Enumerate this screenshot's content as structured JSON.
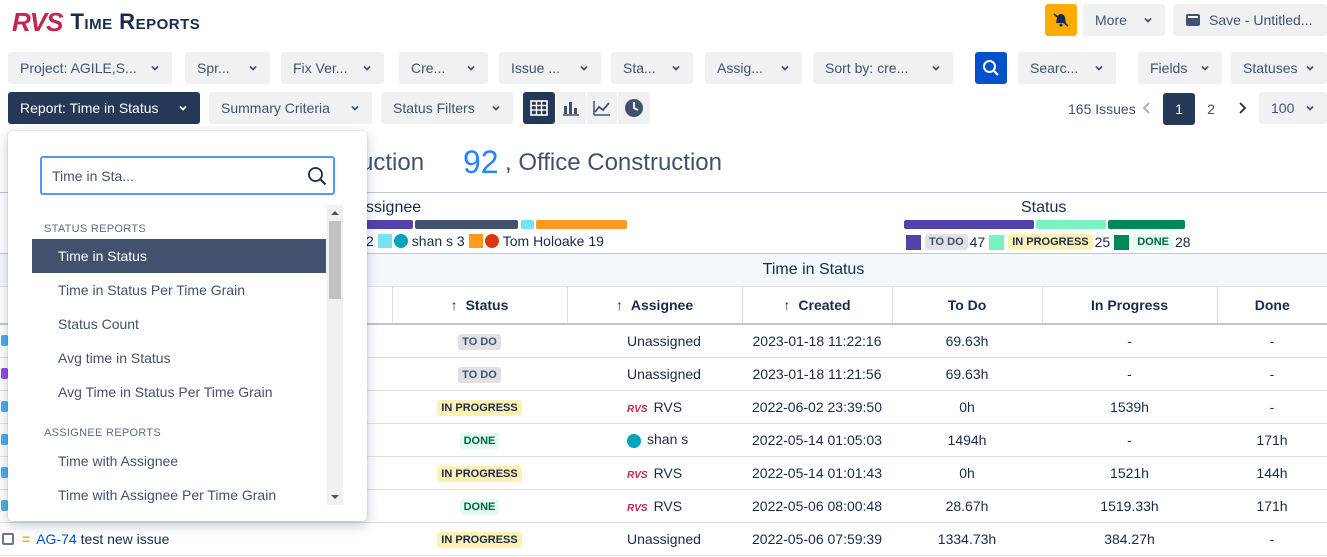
{
  "app": {
    "logo": "RVS",
    "title": "Time Reports"
  },
  "header": {
    "more_label": "More",
    "save_label": "Save - Untitled..."
  },
  "filters": [
    {
      "label": "Project: AGILE,S..."
    },
    {
      "label": "Spr..."
    },
    {
      "label": "Fix Ver..."
    },
    {
      "label": "Cre..."
    },
    {
      "label": "Issue ..."
    },
    {
      "label": "Sta..."
    },
    {
      "label": "Assig..."
    },
    {
      "label": "Sort by: cre..."
    }
  ],
  "search_filter": "Searc...",
  "fields_label": "Fields",
  "statuses_label": "Statuses",
  "report_button": "Report: Time in Status",
  "summary_criteria": "Summary Criteria",
  "status_filters": "Status Filters",
  "pagination": {
    "issues": "165 Issues",
    "pages": [
      "1",
      "2"
    ],
    "per_page": "100"
  },
  "project_titles": {
    "partial": "uction",
    "count": "92",
    "name": ", Office Construction"
  },
  "summary": {
    "assignee_label": "ssignee",
    "assignee_legend": [
      {
        "text": "2"
      },
      {
        "text": "shan s 3"
      },
      {
        "text": "Tom Holoake 19"
      }
    ],
    "status_label": "Status",
    "status_legend": [
      {
        "badge": "TO DO",
        "count": "47"
      },
      {
        "badge": "IN PROGRESS",
        "count": "25"
      },
      {
        "badge": "DONE",
        "count": "28"
      }
    ]
  },
  "table": {
    "group_header": "Time in Status",
    "columns": [
      "Status",
      "Assignee",
      "Created",
      "To Do",
      "In Progress",
      "Done"
    ],
    "sort_arrows": [
      "↑",
      "↑",
      "↑"
    ],
    "rows": [
      {
        "status": "TO DO",
        "assignee": "Unassigned",
        "created": "2023-01-18 11:22:16",
        "todo": "69.63h",
        "inprog": "-",
        "done": "-"
      },
      {
        "status": "TO DO",
        "assignee": "Unassigned",
        "created": "2023-01-18 11:21:56",
        "todo": "69.63h",
        "inprog": "-",
        "done": "-"
      },
      {
        "status": "IN PROGRESS",
        "assignee": "RVS",
        "created": "2022-06-02 23:39:50",
        "todo": "0h",
        "inprog": "1539h",
        "done": "-"
      },
      {
        "status": "DONE",
        "assignee": "shan s",
        "created": "2022-05-14 01:05:03",
        "todo": "1494h",
        "inprog": "-",
        "done": "171h"
      },
      {
        "status": "IN PROGRESS",
        "assignee": "RVS",
        "created": "2022-05-14 01:01:43",
        "todo": "0h",
        "inprog": "1521h",
        "done": "144h"
      },
      {
        "status": "DONE",
        "assignee": "RVS",
        "created": "2022-05-06 08:00:48",
        "todo": "28.67h",
        "inprog": "1519.33h",
        "done": "171h"
      },
      {
        "status": "IN PROGRESS",
        "assignee": "Unassigned",
        "created": "2022-05-06 07:59:39",
        "todo": "1334.73h",
        "inprog": "384.27h",
        "done": "-"
      }
    ],
    "last_issue_key": "AG-74",
    "last_issue_summary": "test new issue"
  },
  "dropdown": {
    "search_value": "Time in Sta...",
    "section1": "STATUS REPORTS",
    "items1": [
      "Time in Status",
      "Time in Status Per Time Grain",
      "Status Count",
      "Avg time in Status",
      "Avg Time in Status Per Time Grain"
    ],
    "section2": "ASSIGNEE REPORTS",
    "items2": [
      "Time with Assignee",
      "Time with Assignee Per Time Grain"
    ]
  },
  "colors": {
    "accent": "#0052cc",
    "navy": "#253858",
    "todo_bar": "#5243aa",
    "inprog_bar": "#79f2c0",
    "done_bar": "#00875a",
    "orange": "#ff991f",
    "cyan": "#79e2f2",
    "yellow": "#ffab00"
  }
}
